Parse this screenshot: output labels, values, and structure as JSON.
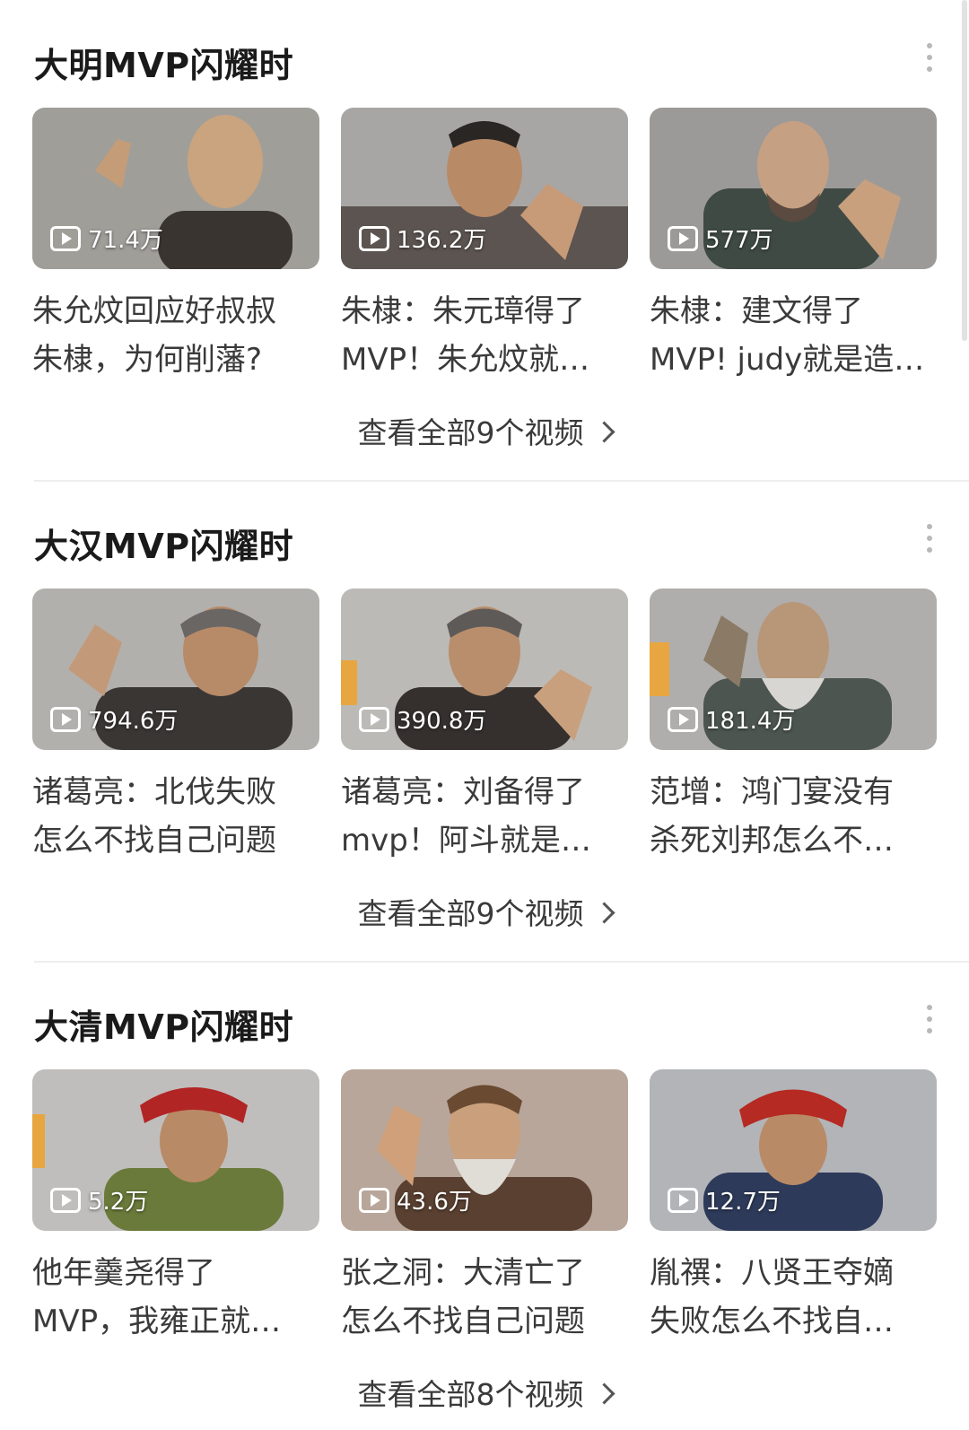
{
  "sections": [
    {
      "title": "大明MVP闪耀时",
      "see_all": "查看全部9个视频",
      "videos": [
        {
          "views": "71.4万",
          "line1": "朱允炆回应好叔叔",
          "line2": "朱棣，为何削藩?"
        },
        {
          "views": "136.2万",
          "line1": "朱棣：朱元璋得了",
          "line2": "MVP！朱允炆就…"
        },
        {
          "views": "577万",
          "line1": "朱棣：建文得了",
          "line2": "MVP! judy就是造…"
        }
      ]
    },
    {
      "title": "大汉MVP闪耀时",
      "see_all": "查看全部9个视频",
      "videos": [
        {
          "views": "794.6万",
          "line1": "诸葛亮：北伐失败",
          "line2": "怎么不找自己问题"
        },
        {
          "views": "390.8万",
          "line1": "诸葛亮：刘备得了",
          "line2": "mvp！阿斗就是…"
        },
        {
          "views": "181.4万",
          "line1": "范增：鸿门宴没有",
          "line2": "杀死刘邦怎么不…"
        }
      ]
    },
    {
      "title": "大清MVP闪耀时",
      "see_all": "查看全部8个视频",
      "videos": [
        {
          "views": "5.2万",
          "line1": "他年羹尧得了",
          "line2": "MVP，我雍正就…"
        },
        {
          "views": "43.6万",
          "line1": "张之洞：大清亡了",
          "line2": "怎么不找自己问题"
        },
        {
          "views": "12.7万",
          "line1": "胤禩：八贤王夺嫡",
          "line2": "失败怎么不找自…"
        }
      ]
    }
  ]
}
